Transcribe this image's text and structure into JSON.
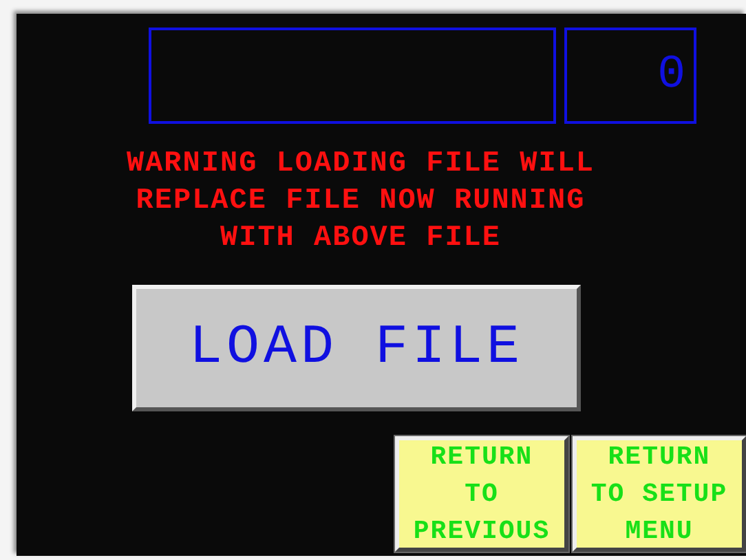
{
  "file_counter": {
    "value": "0"
  },
  "warning": [
    "WARNING LOADING FILE WILL",
    "REPLACE FILE NOW RUNNING",
    "WITH ABOVE FILE"
  ],
  "load_button": {
    "label": "LOAD FILE"
  },
  "nav_buttons": [
    {
      "lines": [
        "RETURN",
        "TO",
        "PREVIOUS"
      ]
    },
    {
      "lines": [
        "RETURN",
        "TO SETUP",
        "MENU"
      ]
    }
  ]
}
